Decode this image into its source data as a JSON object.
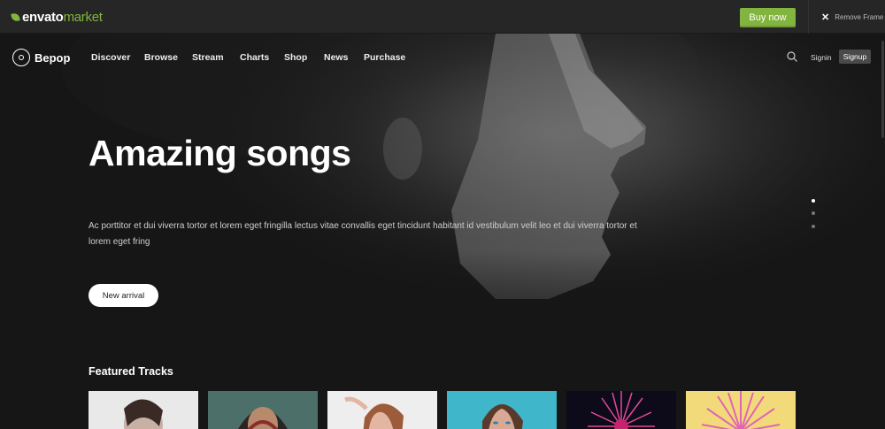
{
  "envato": {
    "logo_word": "envato",
    "logo_market": "market",
    "buy_now_label": "Buy now",
    "remove_frame_label": "Remove Frame"
  },
  "nav": {
    "brand": "Bepop",
    "items": [
      {
        "label": "Discover"
      },
      {
        "label": "Browse"
      },
      {
        "label": "Stream"
      },
      {
        "label": "Charts"
      },
      {
        "label": "Shop"
      },
      {
        "label": "News"
      },
      {
        "label": "Purchase"
      }
    ],
    "signin_label": "Signin",
    "signup_label": "Signup"
  },
  "hero": {
    "title": "Amazing songs",
    "description": "Ac porttitor et dui viverra tortor et lorem eget fringilla lectus vitae convallis eget tincidunt habitant id vestibulum velit leo et dui viverra tortor et lorem eget fring",
    "cta_label": "New arrival",
    "slides": 3,
    "active_slide": 1
  },
  "featured": {
    "title": "Featured Tracks"
  },
  "colors": {
    "envato_green": "#82b440",
    "background": "#161616"
  }
}
